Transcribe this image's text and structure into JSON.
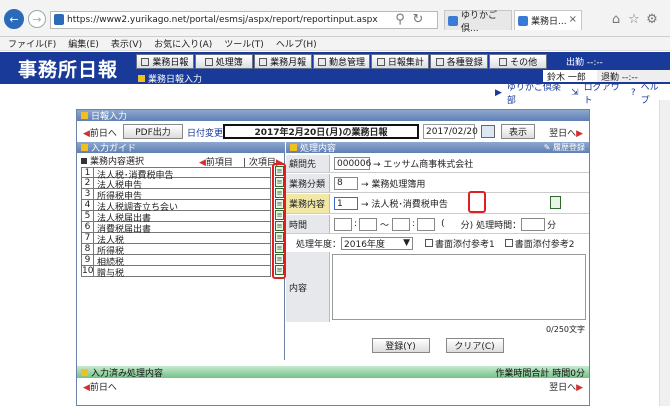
{
  "browser": {
    "url": "https://www2.yurikago.net/portal/esmsj/aspx/report/reportinput.aspx",
    "tabs": [
      {
        "label": "ゆりかご倶..."
      },
      {
        "label": "業務日..."
      }
    ],
    "menu": [
      "ファイル(F)",
      "編集(E)",
      "表示(V)",
      "お気に入り(A)",
      "ツール(T)",
      "ヘルプ(H)"
    ]
  },
  "app": {
    "logo": "事務所日報",
    "nav": [
      "業務日報",
      "処理簿",
      "業務月報",
      "勤怠管理",
      "日報集計",
      "各種登録",
      "その他"
    ],
    "subtitle": "業務日報入力",
    "logout": "出勤 --:--",
    "user": "鈴木 一郎",
    "attend": "退勤 --:--",
    "links": [
      "ゆりかご倶楽部",
      "ログアウト",
      "ヘルプ"
    ]
  },
  "panel": {
    "title": "日報入力",
    "prev_day": "前日へ",
    "pdf_label": "PDF出力",
    "date_change": "日付変更",
    "report_title": "2017年2月20日(月)の業務日報",
    "date_value": "2017/02/20",
    "show_label": "表示",
    "next_day": "翌日へ"
  },
  "guide": {
    "title": "入力ガイド",
    "subtitle": "業務内容選択",
    "prev": "前項目",
    "next": "次項目",
    "items": [
      {
        "num": "1",
        "text": "法人税･消費税申告"
      },
      {
        "num": "2",
        "text": "法人税申告"
      },
      {
        "num": "3",
        "text": "所得税申告"
      },
      {
        "num": "4",
        "text": "法人税調査立ち会い"
      },
      {
        "num": "5",
        "text": "法人税届出書"
      },
      {
        "num": "6",
        "text": "消費税届出書"
      },
      {
        "num": "7",
        "text": "法人税"
      },
      {
        "num": "8",
        "text": "所得税"
      },
      {
        "num": "9",
        "text": "相続税"
      },
      {
        "num": "10",
        "text": "贈与税"
      }
    ]
  },
  "form": {
    "title": "処理内容",
    "history_link": "履歴登録",
    "client_label": "顧問先",
    "client_code": "000006",
    "client_name": "→ エッサム商事株式会社",
    "type_label": "業務分類",
    "type_code": "8",
    "type_name": "→ 業務処理簿用",
    "content_label": "業務内容",
    "content_code": "1",
    "content_name": "→ 法人税･消費税申告",
    "time_label": "時間",
    "time_sep": "～",
    "time_open": "(",
    "time_min_unit": "分)",
    "proc_time_label": "処理時間：",
    "proc_unit": "分",
    "year_label": "処理年度：",
    "year_value": "2016年度",
    "attach1": "書面添付参考1",
    "attach2": "書面添付参考2",
    "body_label": "内容",
    "char_count": "0/250文字",
    "register_btn": "登録(Y)",
    "clear_btn": "クリア(C)"
  },
  "done": {
    "title": "入力済み処理内容",
    "total": "作業時間合計 時間0分",
    "prev": "前日へ",
    "next": "翌日へ"
  }
}
